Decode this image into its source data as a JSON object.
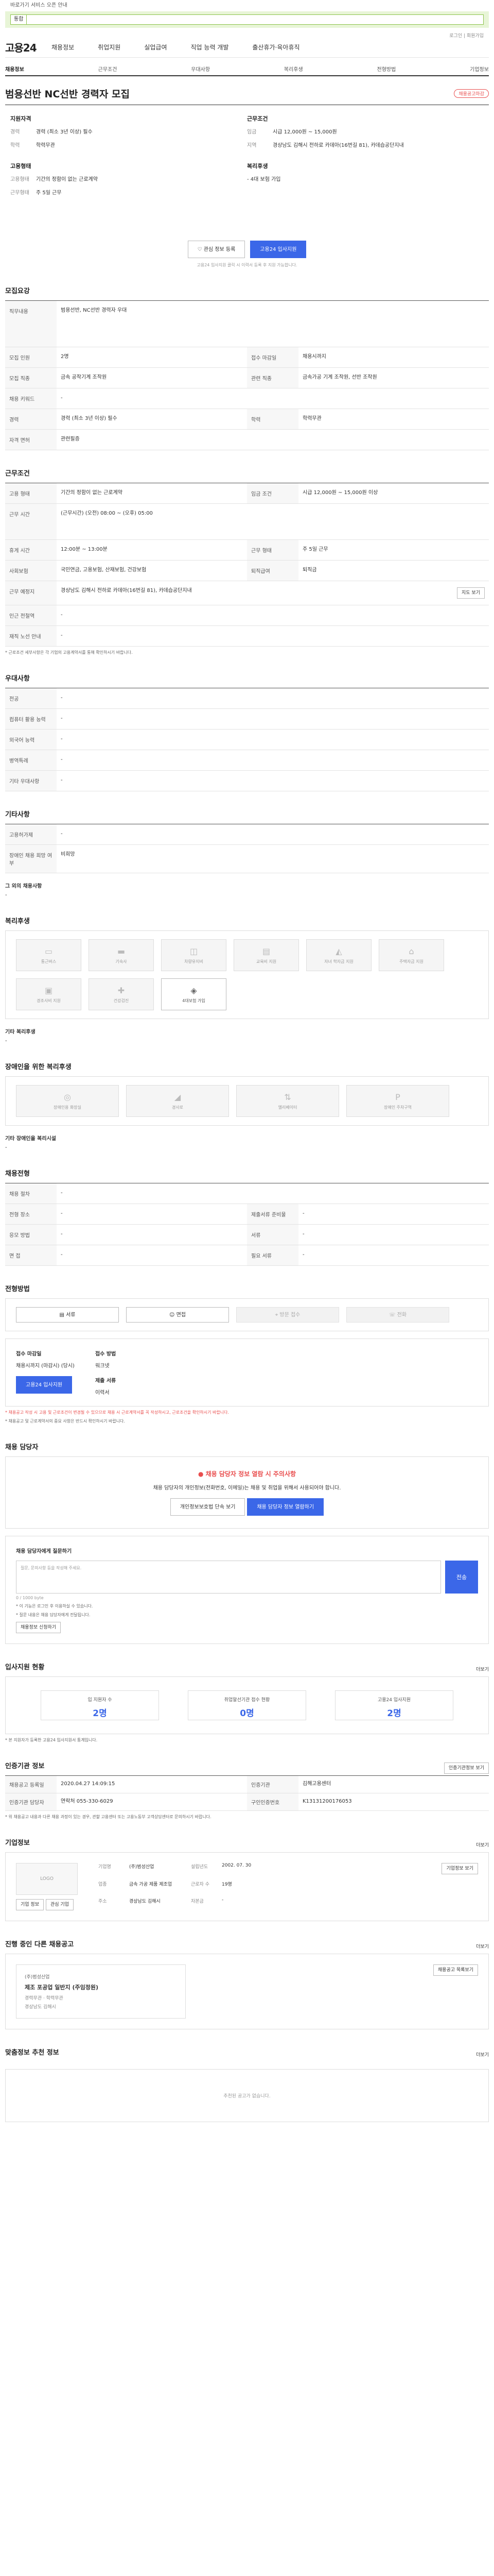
{
  "top": {
    "notice": "바로가기 서비스 오픈 안내",
    "search_select": "통합",
    "search_placeholder": "",
    "topright": "로그인 | 회원가입"
  },
  "gnb": {
    "logo": "고용24",
    "menu": [
      "채용정보",
      "취업지원",
      "실업급여",
      "직업 능력 개발",
      "출산휴가·육아휴직"
    ]
  },
  "subnav": [
    "채용정보",
    "근무조건",
    "우대사항",
    "복리후생",
    "전형방법",
    "기업정보"
  ],
  "header": {
    "title": "범용선반 NC선반 경력자 모집",
    "badge": "채용공고마감"
  },
  "summary": {
    "left_title": "지원자격",
    "left": [
      {
        "k": "경력",
        "v": "경력 (최소 3년 이상) 필수"
      },
      {
        "k": "학력",
        "v": "학력무관"
      }
    ],
    "left2_title": "고용형태",
    "left2": [
      {
        "k": "고용형태",
        "v": "기간의 정함이 없는 근로계약"
      },
      {
        "k": "근무형태",
        "v": "주 5일 근무"
      }
    ],
    "right_title": "근무조건",
    "right": [
      {
        "k": "임금",
        "v": "시급 12,000원 ~ 15,000원"
      },
      {
        "k": "지역",
        "v": "경상남도 김해시 전하로 카데아(16번길 81), 카데습공단지내"
      }
    ],
    "right2_title": "복리후생",
    "right2": [
      {
        "k": "",
        "v": "- 4대 보험 가입"
      }
    ]
  },
  "buttons": {
    "interest": "관심 정보 등록",
    "apply": "고용24 입사지원",
    "footnote": "고용24 입사지원 클릭 시 이력서 등록 후 지원 가능합니다."
  },
  "recruit": {
    "title": "모집요강",
    "job_th": "직무내용",
    "job_td": "범용선반, NC선반 경력자 우대",
    "rows": [
      {
        "th": "모집 인원",
        "td": "2명",
        "th2": "접수 마감일",
        "td2": "채용시까지"
      },
      {
        "th": "모집 직종",
        "td": "금속 공작기계 조작원",
        "th2": "관련 직종",
        "td2": "금속가공 기계 조작원, 선반 조작원"
      },
      {
        "th": "채용 키워드",
        "td": "-",
        "th2": "",
        "td2": ""
      },
      {
        "th": "경력",
        "td": "경력 (최소 3년 이상) 필수",
        "th2": "학력",
        "td2": "학력무관"
      },
      {
        "th": "자격 면허",
        "td": "관련필증",
        "th2": "",
        "td2": ""
      }
    ]
  },
  "work": {
    "title": "근무조건",
    "rows": [
      {
        "th": "고용 형태",
        "td": "기간의 정함이 없는 근로계약",
        "th2": "임금 조건",
        "td2": "시급 12,000원 ~ 15,000원 이상"
      },
      {
        "th": "근무 시간",
        "td": "(근무시간) (오전) 08:00 ~ (오후) 05:00",
        "th2": "",
        "td2": ""
      },
      {
        "th": "휴게 시간",
        "td": "12:00분 ~ 13:00분",
        "th2": "근무 형태",
        "td2": "주 5일 근무"
      },
      {
        "th": "사회보험",
        "td": "국민연금, 고용보험, 산재보험, 건강보험",
        "th2": "퇴직급여",
        "td2": "퇴직금"
      },
      {
        "th": "근무 예정지",
        "td": "경상남도 김해시 전하로 카데아(16번길 81), 카데습공단지내",
        "th2": "",
        "td2": ""
      },
      {
        "th": "인근 전철역",
        "td": "-",
        "th2": "",
        "td2": ""
      },
      {
        "th": "재직 노선 안내",
        "td": "-",
        "th2": "",
        "td2": ""
      }
    ],
    "map_btn": "지도 보기",
    "note": "* 근로조건 세부사항은 각 기업의 고용계약서를 통해 확인하시기 바랍니다."
  },
  "prefer": {
    "title": "우대사항",
    "rows": [
      {
        "th": "전공",
        "td": "-"
      },
      {
        "th": "컴퓨터 활용 능력",
        "td": "-"
      },
      {
        "th": "외국어 능력",
        "td": "-"
      },
      {
        "th": "병역특례",
        "td": "-"
      },
      {
        "th": "기타 우대사항",
        "td": "-"
      }
    ]
  },
  "etc": {
    "title": "기타사항",
    "rows": [
      {
        "th": "고용허가제",
        "td": "-"
      },
      {
        "th": "장애인 채용 희망 여부",
        "td": "비희망"
      }
    ],
    "sub_title": "그 외의 채용사항",
    "sub_text": "-"
  },
  "welfare": {
    "title": "복리후생",
    "items": [
      "통근버스",
      "기숙사",
      "차량유지비",
      "교육비 지원",
      "자녀 학자금 지원",
      "주택자금 지원",
      "경조사비 지원",
      "건강검진",
      "4대보험 가입"
    ],
    "on_index": 8,
    "other_title": "기타 복리후생",
    "other_text": "-"
  },
  "disab": {
    "title": "장애인을 위한 복리후생",
    "items": [
      "장애인용 화장실",
      "경사로",
      "엘리베이터",
      "장애인 주차구역"
    ],
    "other_title": "기타 장애인을 복리시설",
    "other_text": "-"
  },
  "proc": {
    "title": "채용전형",
    "rows": [
      {
        "th": "채용 절차",
        "td": "-"
      },
      {
        "th": "전형 장소",
        "td": "-",
        "th2": "제출서류 준비물",
        "td2": "-"
      },
      {
        "th": "응모 방법",
        "td": "-",
        "th2": "서류",
        "td2": "-"
      },
      {
        "th": "면 접",
        "td": "-",
        "th2": "필요 서류",
        "td2": "-"
      }
    ]
  },
  "apply": {
    "title": "전형방법",
    "btns": [
      "서류",
      "면접",
      "방문 접수",
      "전화"
    ],
    "deadline_th": "접수 마감일",
    "deadline_td": "채용시까지 (마감시) (당시)",
    "method_th": "접수 방법",
    "method_td": "워크넷",
    "method2_th": "제출 서류",
    "method2_td": "이력서",
    "apply_btn": "고용24 입사지원",
    "notes": [
      "* 채용공고 작성 시 고용 및 근로조건이 변경될 수 있으므로 채용 시 근로계약서를 꼭 작성하시고, 근로조건을 확인하시기 바랍니다.",
      "* 채용공고 및 근로계약서의 중요 사항은 반드시 확인하시기 바랍니다."
    ]
  },
  "manager": {
    "title": "채용 담당자",
    "warn": "채용 담당자 정보 열람 시 주의사항",
    "text": "채용 담당자의 개인정보(전화번호, 이메일)는 채용 및 취업을 위해서 사용되어야 합니다.",
    "btn1": "개인정보보호법 단속 보기",
    "btn2": "채용 담당자 정보 열람하기"
  },
  "memo": {
    "title": "채용 담당자에게 질문하기",
    "placeholder": "질문, 문의사항 등을 작성해 주세요.",
    "save": "전송",
    "count": "0 / 1000 byte",
    "notes": [
      "* 이 기능은 로그인 후 이용하실 수 있습니다.",
      "* 질문 내용은 채용 담당자에게 전달됩니다."
    ],
    "reg_btn": "채용정보 신청하기"
  },
  "stats": {
    "title": "입사지원 현황",
    "more": "더보기",
    "items": [
      {
        "label": "입 지원자 수",
        "value": "2명"
      },
      {
        "label": "취업알선기관 접수 현황",
        "value": "0명"
      },
      {
        "label": "고용24 입사지원",
        "value": "2명"
      }
    ],
    "note": "* 본 지원자가 등록한 고용24 입사지원서 통계입니다."
  },
  "info": {
    "title": "인증기관 정보",
    "btn": "인증기관정보 보기",
    "rows": [
      {
        "th": "채용공고 등록일",
        "td": "2020.04.27 14:09:15",
        "th2": "인증기관",
        "td2": "김해고용센터"
      },
      {
        "th": "인증기관 담당자",
        "td": "연락처 055-330-6029",
        "th2": "구인인증번호",
        "td2": "K13131200176053"
      }
    ],
    "note": "* 위 채용공고 내용과 다른 채용 과정이 있는 경우, 관할 고용센터 또는 고용노동부 고객상담센터로 문의하시기 바랍니다."
  },
  "corp": {
    "title": "기업정보",
    "more": "더보기",
    "logo_text": "LOGO",
    "btn_a": "기업 정보",
    "btn_b": "관심 기업",
    "grid": [
      {
        "k": "기업명",
        "v": "(주)범성산업"
      },
      {
        "k": "설립년도",
        "v": "2002. 07. 30"
      },
      {
        "k": "업종",
        "v": "금속 가공 제품 제조업"
      },
      {
        "k": "근로자 수",
        "v": "19명"
      },
      {
        "k": "주소",
        "v": "경상남도 김해시"
      },
      {
        "k": "자본금",
        "v": "-"
      }
    ],
    "right_btn": "기업정보 보기"
  },
  "ongoing": {
    "title": "진행 중인 다른 채용공고",
    "more": "더보기",
    "card_company": "(주)범성산업",
    "card_title": "제조 포공업 일반지 (주임정원)",
    "card_meta": "경력무관 · 학력무관",
    "card_place": "경상남도 김해시",
    "card_right": "채용공고 목록보기"
  },
  "recommend": {
    "title": "맞춤정보 추천 정보",
    "more": "더보기",
    "empty": "추천된 공고가 없습니다."
  }
}
